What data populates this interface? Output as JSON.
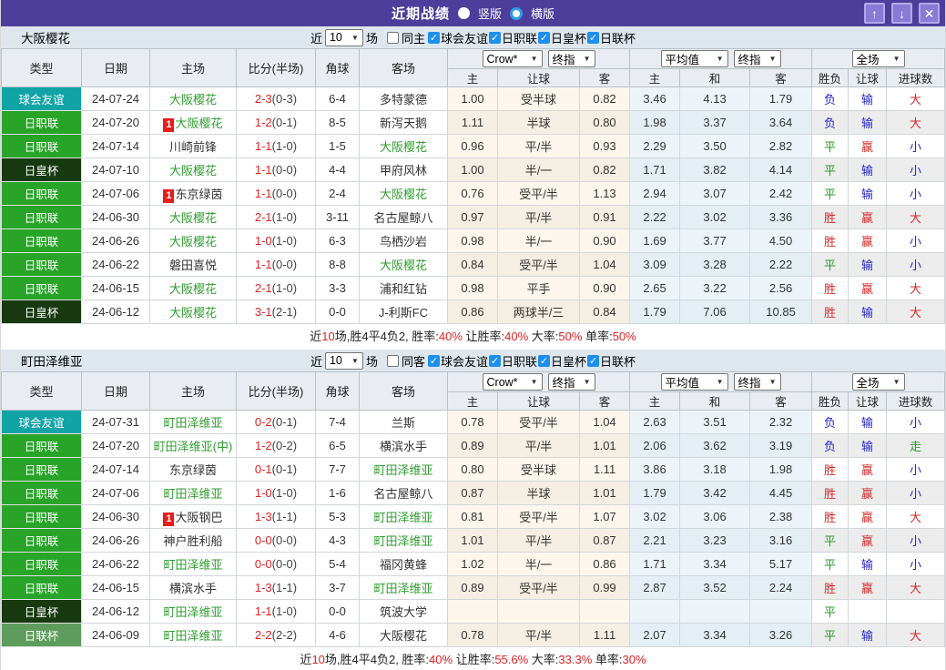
{
  "titlebar": {
    "title": "近期战绩",
    "radio_vertical": "竖版",
    "radio_horizontal": "横版",
    "up_button": "↑",
    "down_button": "↓",
    "close_button": "✕"
  },
  "labels": {
    "near": "近",
    "count": "10",
    "unit": "场",
    "col_type": "类型",
    "col_date": "日期",
    "col_home": "主场",
    "col_score": "比分(半场)",
    "col_corner": "角球",
    "col_away": "客场",
    "dd_crow": "Crow*",
    "dd_final1": "终指",
    "dd_avg": "平均值",
    "dd_final2": "终指",
    "dd_full": "全场",
    "sub_home": "主",
    "sub_hcap": "让球",
    "sub_away": "客",
    "sub_avg_home": "主",
    "sub_draw": "和",
    "sub_avg_away": "客",
    "sub_wl": "胜负",
    "sub_hcap2": "让球",
    "sub_goals": "进球数"
  },
  "colors": {
    "titlebar_bg": "#4e3e9c",
    "button_bg": "#8a7ad8",
    "filterbar_bg": "#dee7ee",
    "header_bg": "#e9edf1",
    "checkbox_blue": "#1f8fee",
    "team_green": "#2f9e2f",
    "score_red": "#e02222",
    "type_colors": {
      "球会友谊": "#12a3a6",
      "日职联": "#28a428",
      "日皇杯": "#173a10",
      "日联杯": "#5e9c5e"
    },
    "result_colors": {
      "胜": "#d42a2a",
      "赢": "#d42a2a",
      "大": "#d42a2a",
      "平": "#2a9a2a",
      "走": "#2a9a2a",
      "负": "#2525cc",
      "输": "#2525cc",
      "小": "#2525cc"
    }
  },
  "sections": [
    {
      "team": "大阪樱花",
      "same_label": "同主",
      "checks": [
        "球会友谊",
        "日职联",
        "日皇杯",
        "日联杯"
      ],
      "rows": [
        {
          "type": "球会友谊",
          "date": "24-07-24",
          "home": {
            "text": "大阪樱花",
            "green": true,
            "badge": false
          },
          "score": "2-3",
          "half": "(0-3)",
          "corner": "6-4",
          "away": {
            "text": "多特蒙德",
            "green": false
          },
          "odds": [
            "1.00",
            "受半球",
            "0.82"
          ],
          "avg": [
            "3.46",
            "4.13",
            "1.79"
          ],
          "res": [
            "负",
            "输",
            "大"
          ]
        },
        {
          "type": "日职联",
          "date": "24-07-20",
          "home": {
            "text": "大阪樱花",
            "green": true,
            "badge": true
          },
          "score": "1-2",
          "half": "(0-1)",
          "corner": "8-5",
          "away": {
            "text": "新泻天鹅",
            "green": false
          },
          "odds": [
            "1.11",
            "半球",
            "0.80"
          ],
          "avg": [
            "1.98",
            "3.37",
            "3.64"
          ],
          "res": [
            "负",
            "输",
            "大"
          ]
        },
        {
          "type": "日职联",
          "date": "24-07-14",
          "home": {
            "text": "川崎前锋",
            "green": false,
            "badge": false
          },
          "score": "1-1",
          "half": "(1-0)",
          "corner": "1-5",
          "away": {
            "text": "大阪樱花",
            "green": true
          },
          "odds": [
            "0.96",
            "平/半",
            "0.93"
          ],
          "avg": [
            "2.29",
            "3.50",
            "2.82"
          ],
          "res": [
            "平",
            "赢",
            "小"
          ]
        },
        {
          "type": "日皇杯",
          "date": "24-07-10",
          "home": {
            "text": "大阪樱花",
            "green": true,
            "badge": false
          },
          "score": "1-1",
          "half": "(0-0)",
          "corner": "4-4",
          "away": {
            "text": "甲府风林",
            "green": false
          },
          "odds": [
            "1.00",
            "半/一",
            "0.82"
          ],
          "avg": [
            "1.71",
            "3.82",
            "4.14"
          ],
          "res": [
            "平",
            "输",
            "小"
          ]
        },
        {
          "type": "日职联",
          "date": "24-07-06",
          "home": {
            "text": "东京绿茵",
            "green": false,
            "badge": true
          },
          "score": "1-1",
          "half": "(0-0)",
          "corner": "2-4",
          "away": {
            "text": "大阪樱花",
            "green": true
          },
          "odds": [
            "0.76",
            "受平/半",
            "1.13"
          ],
          "avg": [
            "2.94",
            "3.07",
            "2.42"
          ],
          "res": [
            "平",
            "输",
            "小"
          ]
        },
        {
          "type": "日职联",
          "date": "24-06-30",
          "home": {
            "text": "大阪樱花",
            "green": true,
            "badge": false
          },
          "score": "2-1",
          "half": "(1-0)",
          "corner": "3-11",
          "away": {
            "text": "名古屋鲸八",
            "green": false
          },
          "odds": [
            "0.97",
            "平/半",
            "0.91"
          ],
          "avg": [
            "2.22",
            "3.02",
            "3.36"
          ],
          "res": [
            "胜",
            "赢",
            "大"
          ]
        },
        {
          "type": "日职联",
          "date": "24-06-26",
          "home": {
            "text": "大阪樱花",
            "green": true,
            "badge": false
          },
          "score": "1-0",
          "half": "(1-0)",
          "corner": "6-3",
          "away": {
            "text": "鸟栖沙岩",
            "green": false
          },
          "odds": [
            "0.98",
            "半/一",
            "0.90"
          ],
          "avg": [
            "1.69",
            "3.77",
            "4.50"
          ],
          "res": [
            "胜",
            "赢",
            "小"
          ]
        },
        {
          "type": "日职联",
          "date": "24-06-22",
          "home": {
            "text": "磐田喜悦",
            "green": false,
            "badge": false
          },
          "score": "1-1",
          "half": "(0-0)",
          "corner": "8-8",
          "away": {
            "text": "大阪樱花",
            "green": true
          },
          "odds": [
            "0.84",
            "受平/半",
            "1.04"
          ],
          "avg": [
            "3.09",
            "3.28",
            "2.22"
          ],
          "res": [
            "平",
            "输",
            "小"
          ]
        },
        {
          "type": "日职联",
          "date": "24-06-15",
          "home": {
            "text": "大阪樱花",
            "green": true,
            "badge": false
          },
          "score": "2-1",
          "half": "(1-0)",
          "corner": "3-3",
          "away": {
            "text": "浦和红钻",
            "green": false
          },
          "odds": [
            "0.98",
            "平手",
            "0.90"
          ],
          "avg": [
            "2.65",
            "3.22",
            "2.56"
          ],
          "res": [
            "胜",
            "赢",
            "大"
          ]
        },
        {
          "type": "日皇杯",
          "date": "24-06-12",
          "home": {
            "text": "大阪樱花",
            "green": true,
            "badge": false
          },
          "score": "3-1",
          "half": "(2-1)",
          "corner": "0-0",
          "away": {
            "text": "J-利斯FC",
            "green": false
          },
          "odds": [
            "0.86",
            "两球半/三",
            "0.84"
          ],
          "avg": [
            "1.79",
            "7.06",
            "10.85"
          ],
          "res": [
            "胜",
            "输",
            "大"
          ]
        }
      ],
      "summary": [
        {
          "t": "近"
        },
        {
          "t": "10",
          "red": true
        },
        {
          "t": "场,胜4平4负2, 胜率:"
        },
        {
          "t": "40%",
          "red": true
        },
        {
          "t": " 让胜率:"
        },
        {
          "t": "40%",
          "red": true
        },
        {
          "t": " 大率:"
        },
        {
          "t": "50%",
          "red": true
        },
        {
          "t": " 单率:"
        },
        {
          "t": "50%",
          "red": true
        }
      ]
    },
    {
      "team": "町田泽维亚",
      "same_label": "同客",
      "checks": [
        "球会友谊",
        "日职联",
        "日皇杯",
        "日联杯"
      ],
      "rows": [
        {
          "type": "球会友谊",
          "date": "24-07-31",
          "home": {
            "text": "町田泽维亚",
            "green": true,
            "badge": false
          },
          "score": "0-2",
          "half": "(0-1)",
          "corner": "7-4",
          "away": {
            "text": "兰斯",
            "green": false
          },
          "odds": [
            "0.78",
            "受平/半",
            "1.04"
          ],
          "avg": [
            "2.63",
            "3.51",
            "2.32"
          ],
          "res": [
            "负",
            "输",
            "小"
          ]
        },
        {
          "type": "日职联",
          "date": "24-07-20",
          "home": {
            "text": "町田泽维亚(中)",
            "green": true,
            "badge": false
          },
          "score": "1-2",
          "half": "(0-2)",
          "corner": "6-5",
          "away": {
            "text": "横滨水手",
            "green": false
          },
          "odds": [
            "0.89",
            "平/半",
            "1.01"
          ],
          "avg": [
            "2.06",
            "3.62",
            "3.19"
          ],
          "res": [
            "负",
            "输",
            "走"
          ]
        },
        {
          "type": "日职联",
          "date": "24-07-14",
          "home": {
            "text": "东京绿茵",
            "green": false,
            "badge": false
          },
          "score": "0-1",
          "half": "(0-1)",
          "corner": "7-7",
          "away": {
            "text": "町田泽维亚",
            "green": true
          },
          "odds": [
            "0.80",
            "受半球",
            "1.11"
          ],
          "avg": [
            "3.86",
            "3.18",
            "1.98"
          ],
          "res": [
            "胜",
            "赢",
            "小"
          ]
        },
        {
          "type": "日职联",
          "date": "24-07-06",
          "home": {
            "text": "町田泽维亚",
            "green": true,
            "badge": false
          },
          "score": "1-0",
          "half": "(1-0)",
          "corner": "1-6",
          "away": {
            "text": "名古屋鲸八",
            "green": false
          },
          "odds": [
            "0.87",
            "半球",
            "1.01"
          ],
          "avg": [
            "1.79",
            "3.42",
            "4.45"
          ],
          "res": [
            "胜",
            "赢",
            "小"
          ]
        },
        {
          "type": "日职联",
          "date": "24-06-30",
          "home": {
            "text": "大阪钢巴",
            "green": false,
            "badge": true
          },
          "score": "1-3",
          "half": "(1-1)",
          "corner": "5-3",
          "away": {
            "text": "町田泽维亚",
            "green": true
          },
          "odds": [
            "0.81",
            "受平/半",
            "1.07"
          ],
          "avg": [
            "3.02",
            "3.06",
            "2.38"
          ],
          "res": [
            "胜",
            "赢",
            "大"
          ]
        },
        {
          "type": "日职联",
          "date": "24-06-26",
          "home": {
            "text": "神户胜利船",
            "green": false,
            "badge": false
          },
          "score": "0-0",
          "half": "(0-0)",
          "corner": "4-3",
          "away": {
            "text": "町田泽维亚",
            "green": true
          },
          "odds": [
            "1.01",
            "平/半",
            "0.87"
          ],
          "avg": [
            "2.21",
            "3.23",
            "3.16"
          ],
          "res": [
            "平",
            "赢",
            "小"
          ]
        },
        {
          "type": "日职联",
          "date": "24-06-22",
          "home": {
            "text": "町田泽维亚",
            "green": true,
            "badge": false
          },
          "score": "0-0",
          "half": "(0-0)",
          "corner": "5-4",
          "away": {
            "text": "福冈黄蜂",
            "green": false
          },
          "odds": [
            "1.02",
            "半/一",
            "0.86"
          ],
          "avg": [
            "1.71",
            "3.34",
            "5.17"
          ],
          "res": [
            "平",
            "输",
            "小"
          ]
        },
        {
          "type": "日职联",
          "date": "24-06-15",
          "home": {
            "text": "横滨水手",
            "green": false,
            "badge": false
          },
          "score": "1-3",
          "half": "(1-1)",
          "corner": "3-7",
          "away": {
            "text": "町田泽维亚",
            "green": true
          },
          "odds": [
            "0.89",
            "受平/半",
            "0.99"
          ],
          "avg": [
            "2.87",
            "3.52",
            "2.24"
          ],
          "res": [
            "胜",
            "赢",
            "大"
          ]
        },
        {
          "type": "日皇杯",
          "date": "24-06-12",
          "home": {
            "text": "町田泽维亚",
            "green": true,
            "badge": false
          },
          "score": "1-1",
          "half": "(1-0)",
          "corner": "0-0",
          "away": {
            "text": "筑波大学",
            "green": false
          },
          "odds": [
            "",
            "",
            ""
          ],
          "avg": [
            "",
            "",
            ""
          ],
          "res": [
            "平",
            "",
            ""
          ]
        },
        {
          "type": "日联杯",
          "date": "24-06-09",
          "home": {
            "text": "町田泽维亚",
            "green": true,
            "badge": false
          },
          "score": "2-2",
          "half": "(2-2)",
          "corner": "4-6",
          "away": {
            "text": "大阪樱花",
            "green": false
          },
          "odds": [
            "0.78",
            "平/半",
            "1.11"
          ],
          "avg": [
            "2.07",
            "3.34",
            "3.26"
          ],
          "res": [
            "平",
            "输",
            "大"
          ]
        }
      ],
      "summary": [
        {
          "t": "近"
        },
        {
          "t": "10",
          "red": true
        },
        {
          "t": "场,胜4平4负2, 胜率:"
        },
        {
          "t": "40%",
          "red": true
        },
        {
          "t": " 让胜率:"
        },
        {
          "t": "55.6%",
          "red": true
        },
        {
          "t": " 大率:"
        },
        {
          "t": "33.3%",
          "red": true
        },
        {
          "t": " 单率:"
        },
        {
          "t": "30%",
          "red": true
        }
      ]
    }
  ]
}
